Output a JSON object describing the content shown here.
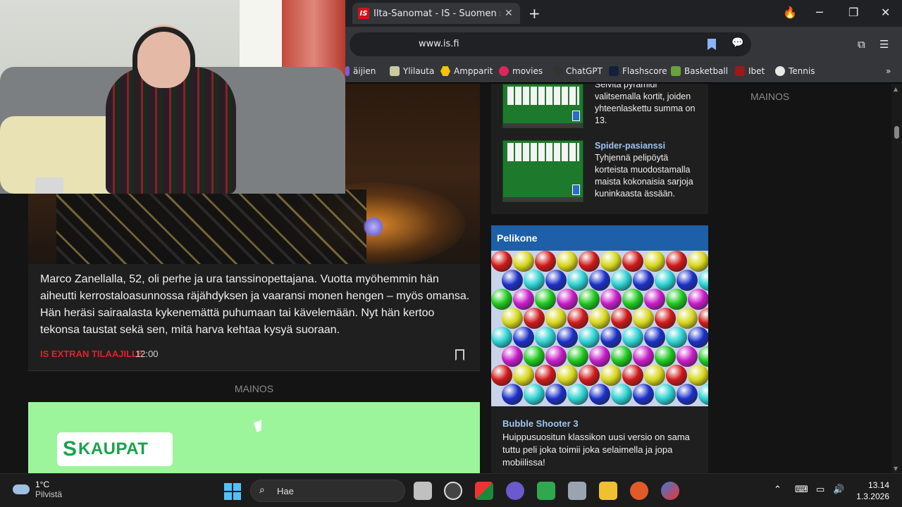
{
  "browser": {
    "tab_title": "Ilta-Sanomat - IS - Suomen su",
    "tab_favicon": "IS",
    "url": "www.is.fi",
    "bookmarks": [
      "äijien",
      "Ylilauta",
      "Ampparit",
      "movies",
      "ChatGPT",
      "Flashscore",
      "Basketball",
      "Ibet",
      "Tennis"
    ]
  },
  "article": {
    "lead": "Marco Zanellalla, 52, oli perhe ja ura tanssinopettajana. Vuotta myöhemmin hän aiheutti kerrostaloasunnossa räjähdyksen ja vaaransi monen hengen – myös omansa. Hän heräsi sairaalasta kykenemättä puhumaan tai kävelemään. Nyt hän kertoo tekonsa taustat sekä sen, mitä harva kehtaa kysyä suoraan.",
    "tag": "IS EXTRAN TILAAJILLE",
    "time": "12:00"
  },
  "ads": {
    "mid_label": "MAINOS",
    "right_label": "MAINOS",
    "brand": "KAUPAT",
    "brand_s": "S"
  },
  "games": {
    "pyramid_text": "Selvitä pyramidi valitsemalla kortit, joiden yhteenlaskettu summa on 13.",
    "spider_title": "Spider-pasianssi",
    "spider_text": "Tyhjennä pelipöytä korteista muodostamalla maista kokonaisia sarjoja kuninkaasta ässään.",
    "pelikone_header": "Pelikone",
    "bubble_title": "Bubble Shooter 3",
    "bubble_text": "Huippusuositun klassikon uusi versio on sama tuttu peli joka toimii joka selaimella ja jopa mobiilissa!"
  },
  "taskbar": {
    "temperature": "1°C",
    "weather": "Pilvistä",
    "search_placeholder": "Hae",
    "time": "13.14",
    "date": "1.3.2026"
  },
  "colors": {
    "accent_red": "#e0222a",
    "pelikone_blue": "#1d5fa8",
    "link_blue": "#9fc4ef",
    "ad_green": "#9cf59a"
  }
}
